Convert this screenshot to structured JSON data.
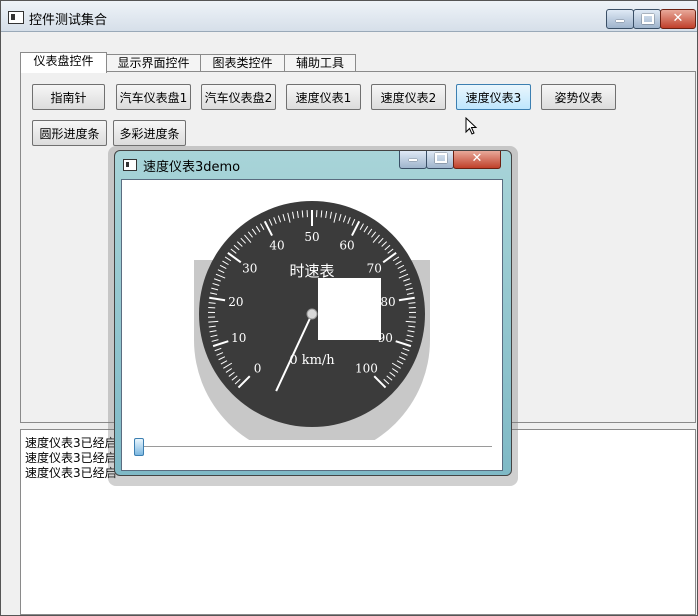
{
  "window": {
    "title": "控件测试集合"
  },
  "tabs": [
    {
      "label": "仪表盘控件",
      "active": true
    },
    {
      "label": "显示界面控件",
      "active": false
    },
    {
      "label": "图表类控件",
      "active": false
    },
    {
      "label": "辅助工具",
      "active": false
    }
  ],
  "buttons": [
    {
      "label": "指南针"
    },
    {
      "label": "汽车仪表盘1"
    },
    {
      "label": "汽车仪表盘2"
    },
    {
      "label": "速度仪表1"
    },
    {
      "label": "速度仪表2"
    },
    {
      "label": "速度仪表3"
    },
    {
      "label": "姿势仪表"
    },
    {
      "label": "圆形进度条"
    },
    {
      "label": "多彩进度条"
    }
  ],
  "log": {
    "lines": [
      "速度仪表3已经启",
      "速度仪表3已经启",
      "速度仪表3已经启"
    ]
  },
  "demo_window": {
    "title": "速度仪表3demo",
    "gauge": {
      "label": "时速表",
      "readout": "0 km/h",
      "value": 0,
      "min": 0,
      "max": 100,
      "ticks": [
        "0",
        "10",
        "20",
        "30",
        "40",
        "50",
        "60",
        "70",
        "80",
        "90",
        "100"
      ]
    },
    "slider": {
      "value": 0
    }
  },
  "icons": {
    "app": "app-window-icon",
    "cursor": "mouse-pointer-icon"
  }
}
